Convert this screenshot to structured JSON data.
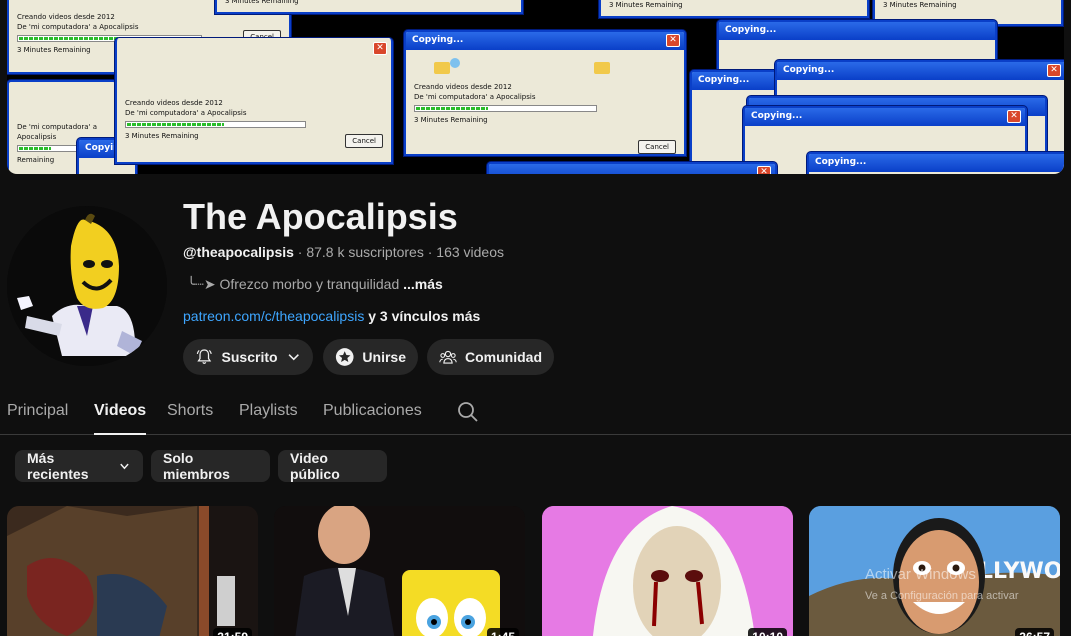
{
  "channel": {
    "name": "The Apocalipsis",
    "handle": "@theapocalipsis",
    "stats": " · 87.8 k suscriptores · 163 videos",
    "description": "╰┈➤ Ofrezco morbo y tranquilidad",
    "description_more": "...más",
    "link": "patreon.com/c/theapocalipsis",
    "link_extra": " y 3 vínculos más"
  },
  "banner": {
    "window_title": "Copying...",
    "line1": "Creando videos desde 2012",
    "line2": "De 'mi computadora' a Apocalipsis",
    "remaining": "3 Minutes Remaining",
    "cancel": "Cancel",
    "remaining_short": "Remaining"
  },
  "actions": {
    "subscribed_label": "Suscrito",
    "join_label": "Unirse",
    "community_label": "Comunidad"
  },
  "tabs": [
    "Principal",
    "Videos",
    "Shorts",
    "Playlists",
    "Publicaciones"
  ],
  "active_tab": "Videos",
  "filters": {
    "sort_label": "Más recientes",
    "members_label": "Solo miembros",
    "public_label": "Video público"
  },
  "videos": [
    {
      "duration": "21:59"
    },
    {
      "duration": "1:45"
    },
    {
      "duration": "10:10"
    },
    {
      "duration": "26:57"
    }
  ],
  "watermark": {
    "line1": "Activar Windows",
    "line2": "Ve a Configuración para activar"
  },
  "colors": {
    "background": "#0f0f0f",
    "pill": "#272727",
    "link": "#3ea6ff",
    "muted_text": "#aaaaaa"
  }
}
